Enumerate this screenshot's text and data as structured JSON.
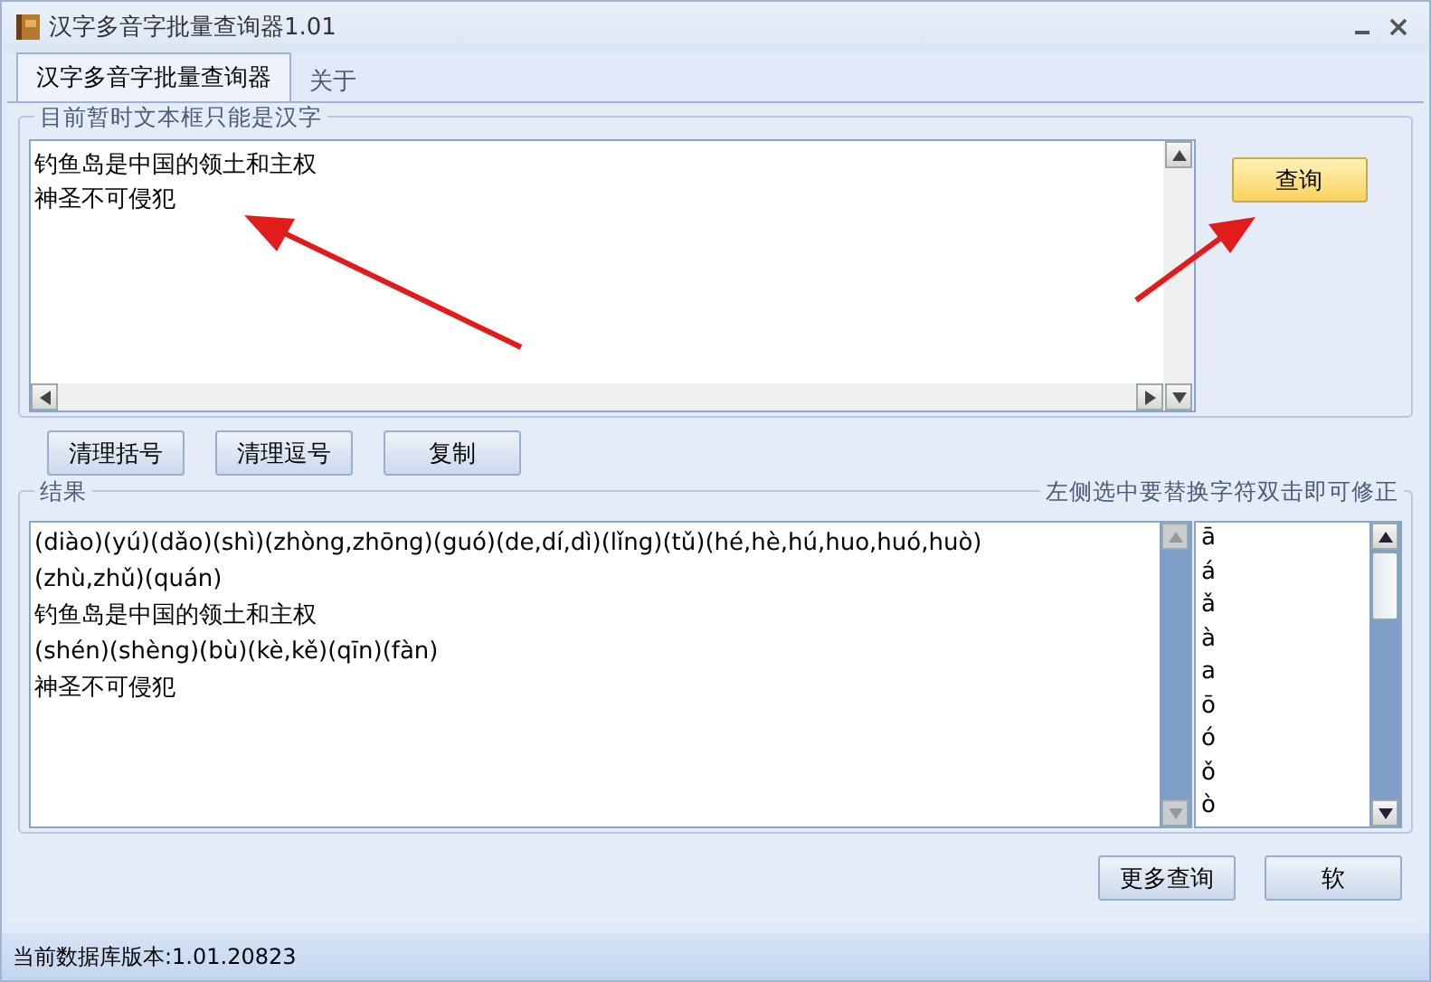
{
  "window": {
    "title": "汉字多音字批量查询器1.01"
  },
  "tabs": [
    {
      "label": "汉字多音字批量查询器",
      "selected": true
    },
    {
      "label": "关于",
      "selected": false
    }
  ],
  "input_group": {
    "legend": "目前暂时文本框只能是汉字",
    "lines": [
      "钓鱼岛是中国的领土和主权",
      "神圣不可侵犯"
    ],
    "query_button": "查询"
  },
  "action_buttons": [
    "清理括号",
    "清理逗号",
    "复制"
  ],
  "results_group": {
    "legend": "结果",
    "hint": "左侧选中要替换字符双击即可修正",
    "lines": [
      "(diào)(yú)(dǎo)(shì)(zhòng,zhōng)(guó)(de,dí,dì)(lǐng)(tǔ)(hé,hè,hú,huo,huó,huò)",
      "(zhù,zhǔ)(quán)",
      "钓鱼岛是中国的领土和主权",
      "(shén)(shèng)(bù)(kè,kě)(qīn)(fàn)",
      "神圣不可侵犯"
    ],
    "characters": [
      "ā",
      "á",
      "ǎ",
      "à",
      "a",
      "ō",
      "ó",
      "ǒ",
      "ò"
    ]
  },
  "footer_buttons": [
    "更多查询",
    "软"
  ],
  "status_bar": "当前数据库版本:1.01.20823"
}
